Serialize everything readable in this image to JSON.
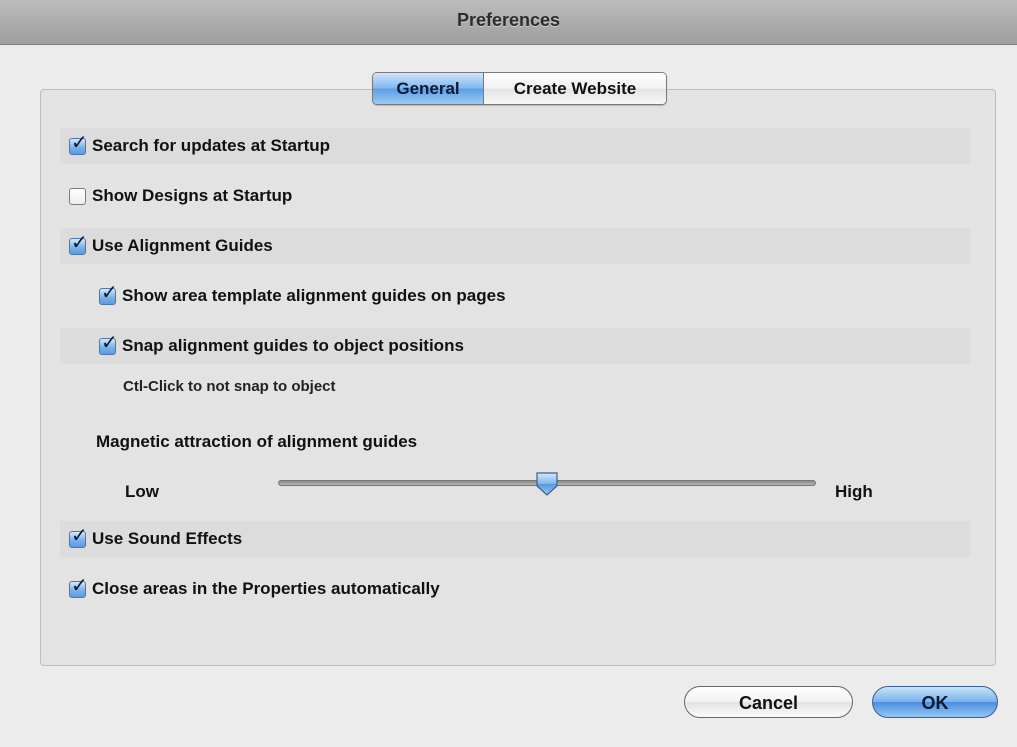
{
  "window": {
    "title": "Preferences"
  },
  "tabs": [
    {
      "label": "General",
      "selected": true
    },
    {
      "label": "Create Website",
      "selected": false
    }
  ],
  "options": {
    "search_updates": {
      "label": "Search for updates at Startup",
      "checked": true
    },
    "show_designs": {
      "label": "Show Designs at Startup",
      "checked": false
    },
    "use_alignment_guides": {
      "label": "Use Alignment Guides",
      "checked": true
    },
    "show_area_template_guides": {
      "label": "Show area template alignment guides on pages",
      "checked": true
    },
    "snap_guides": {
      "label": "Snap alignment guides to object positions",
      "checked": true
    },
    "snap_note": "Ctl-Click to not snap to object",
    "use_sound_effects": {
      "label": "Use Sound Effects",
      "checked": true
    },
    "close_areas": {
      "label": "Close areas in the Properties automatically",
      "checked": true
    }
  },
  "magnetic": {
    "label": "Magnetic attraction of alignment guides",
    "low_label": "Low",
    "high_label": "High",
    "value_fraction": 0.5
  },
  "buttons": {
    "cancel": "Cancel",
    "ok": "OK"
  },
  "colors": {
    "accent_blue": "#5b9de5",
    "window_bg": "#ececec",
    "titlebar": "#a9a9a9"
  }
}
